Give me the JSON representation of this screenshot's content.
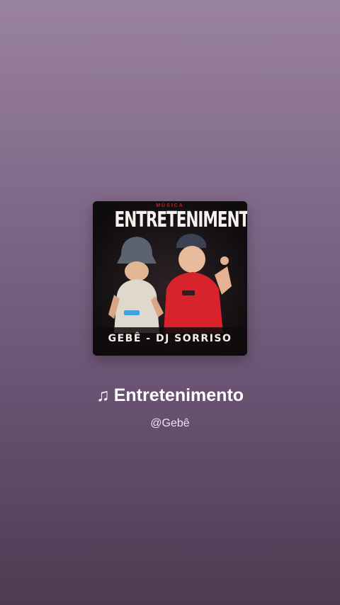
{
  "album_art": {
    "title": "ENTRETENIMENTO",
    "small_text": "MÚSICA",
    "bottom_text": "GEBÊ - DJ SORRISO",
    "colors": {
      "background": "#161214",
      "red_shirt": "#d8222c",
      "accent_red": "#c61a26"
    }
  },
  "track": {
    "note_icon": "♫",
    "title": "Entretenimento",
    "artist": "@Gebê"
  },
  "colors": {
    "background_top": "#9a839e",
    "background_bottom": "#4e3a52",
    "title_text": "#ffffff"
  }
}
